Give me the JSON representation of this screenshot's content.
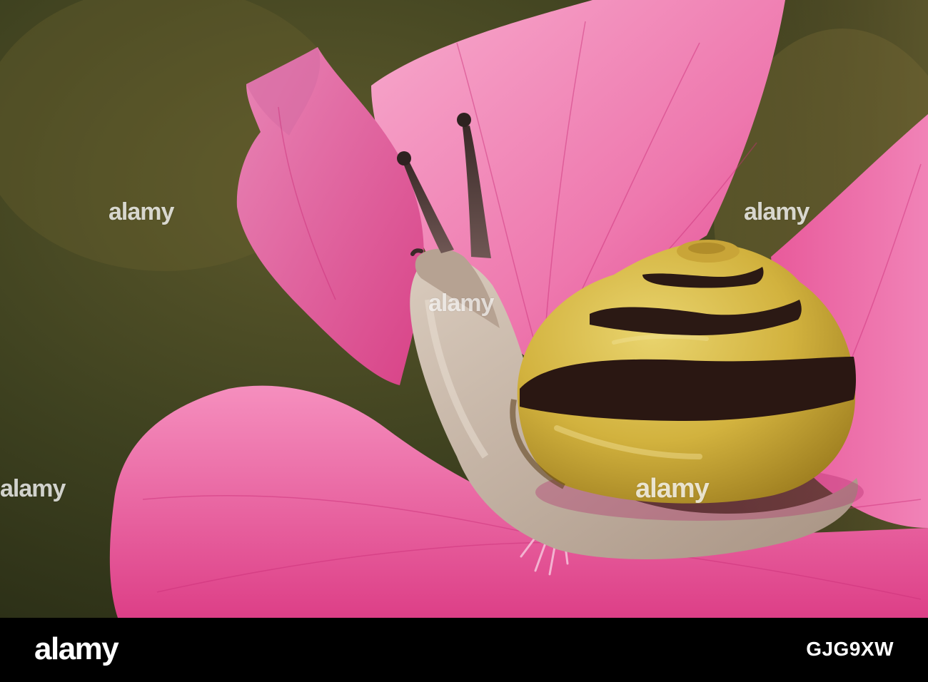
{
  "photo": {
    "subject": "snail-on-pink-flower",
    "colors": {
      "background_dark": "#2f3319",
      "background_light": "#5a5a2a",
      "petal_pink": "#e8569a",
      "petal_light": "#f59ac4",
      "shell_yellow": "#d4b43c",
      "shell_band": "#2a1810",
      "snail_body": "#c8b8a8"
    }
  },
  "watermark": {
    "text": "alamy"
  },
  "footer": {
    "logo_text": "alamy",
    "image_id": "GJG9XW"
  }
}
